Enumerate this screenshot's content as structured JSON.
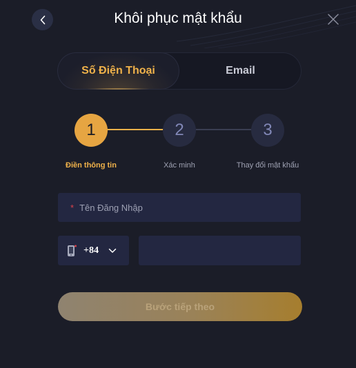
{
  "header": {
    "title": "Khôi phục mật khẩu",
    "back_icon": "chevron-left-icon",
    "close_icon": "close-icon"
  },
  "tabs": [
    {
      "label": "Số Điện Thoại",
      "active": true
    },
    {
      "label": "Email",
      "active": false
    }
  ],
  "steps": [
    {
      "number": "1",
      "label": "Điền thông tin",
      "active": true
    },
    {
      "number": "2",
      "label": "Xác minh",
      "active": false
    },
    {
      "number": "3",
      "label": "Thay đổi mật khẩu",
      "active": false
    }
  ],
  "form": {
    "username_placeholder": "Tên Đăng Nhập",
    "required_mark": "*",
    "country_code": "+84",
    "phone_value": "",
    "submit_label": "Bước tiếp theo"
  },
  "colors": {
    "background": "#1b1d28",
    "accent": "#f0b24a",
    "field": "#232741",
    "step_inactive": "#272b40"
  }
}
